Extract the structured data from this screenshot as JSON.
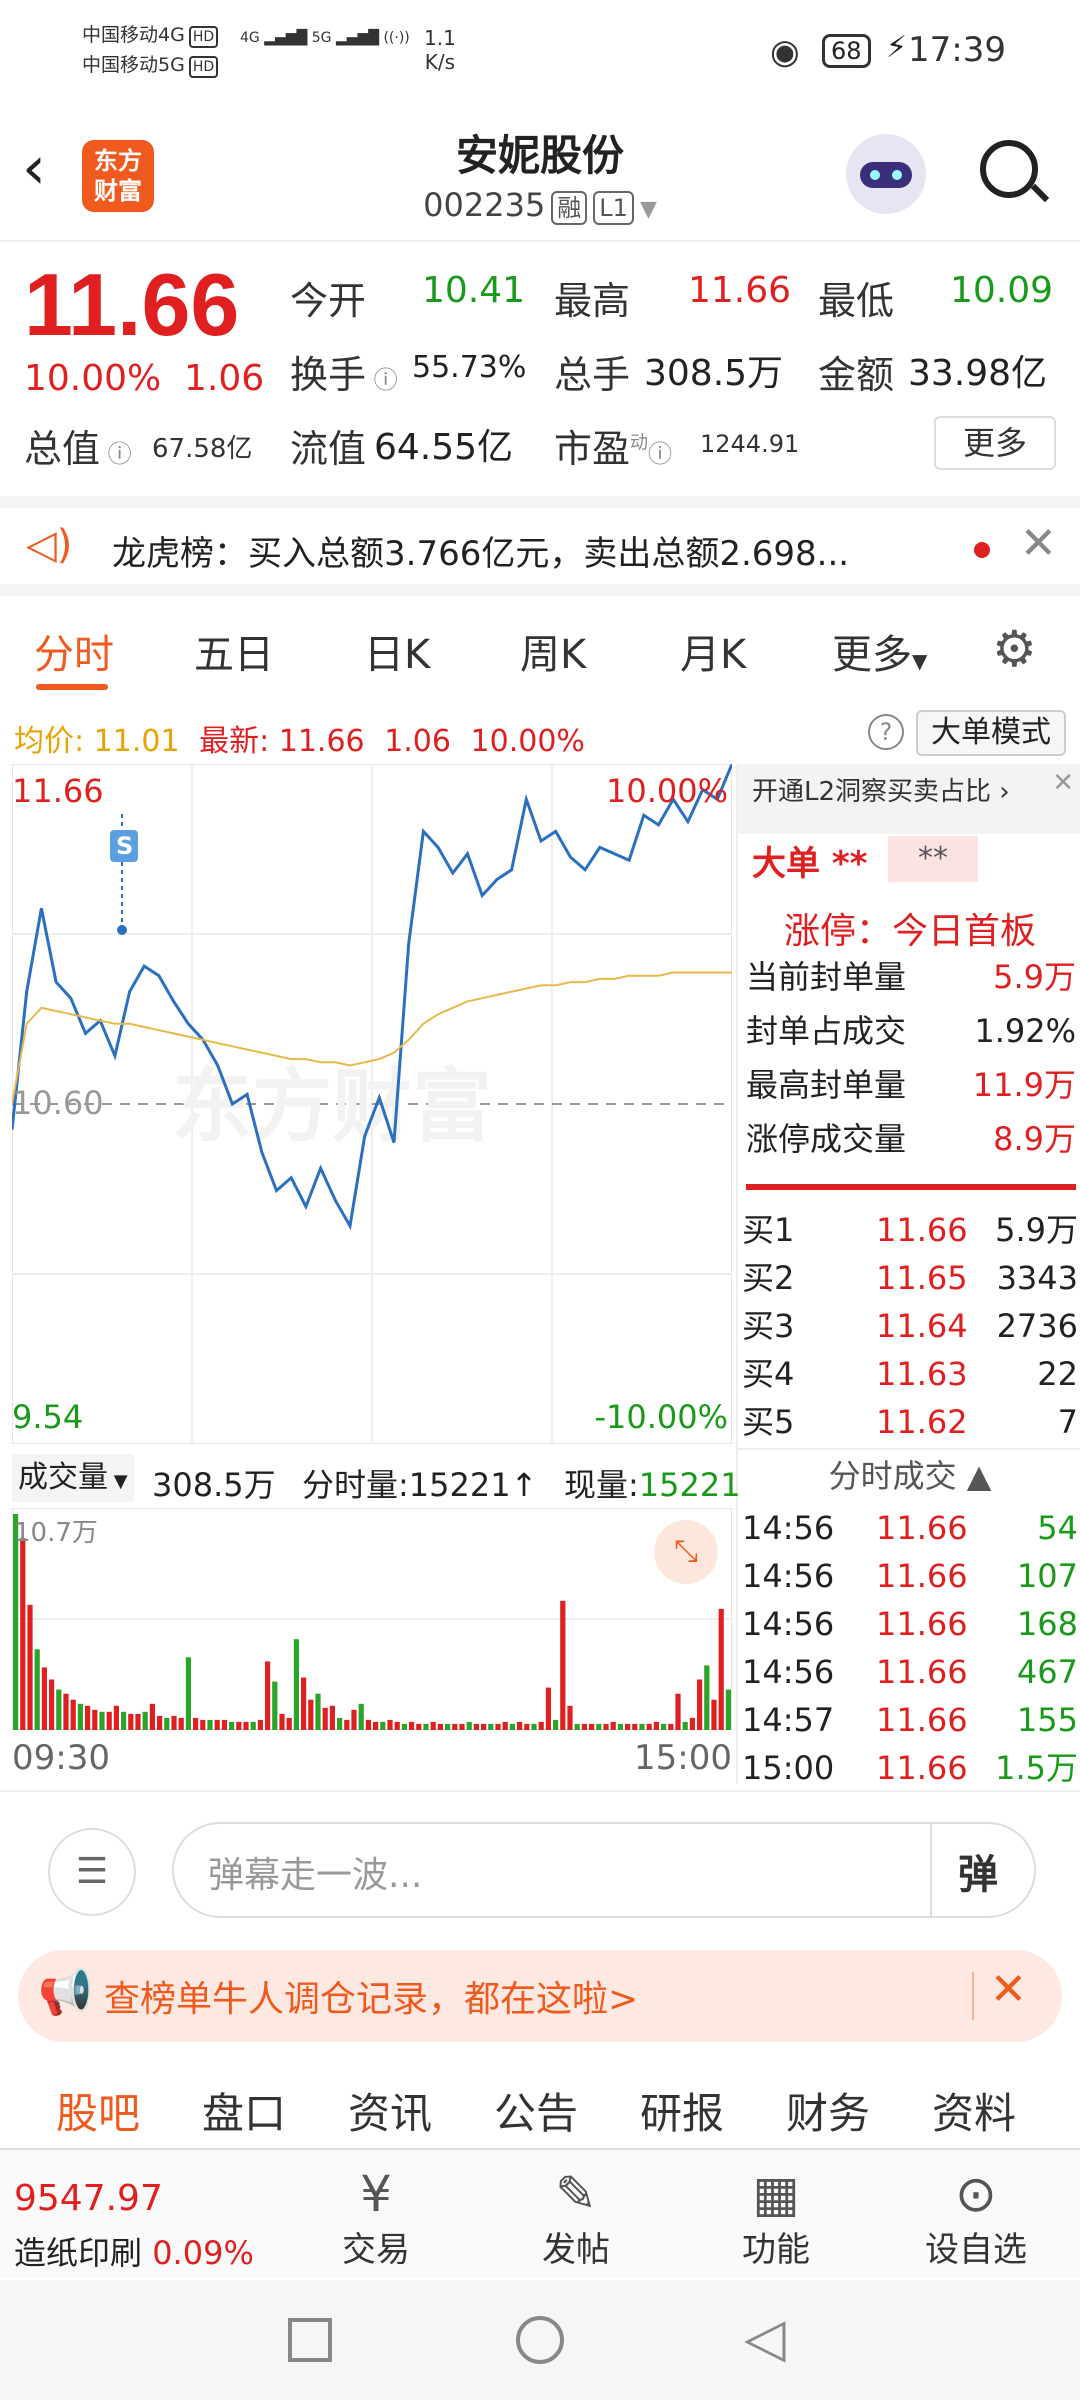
{
  "status": {
    "carrier1": "中国移动4G",
    "carrier2": "中国移动5G",
    "hd": "HD",
    "net1": "4G",
    "net2": "5G",
    "speed": "1.1",
    "speed_unit": "K/s",
    "battery": "68",
    "time": "17:39"
  },
  "header": {
    "logo_line1": "东方",
    "logo_line2": "财富",
    "title": "安妮股份",
    "code": "002235",
    "tag1": "融",
    "tag2": "L1"
  },
  "quote": {
    "price": "11.66",
    "change_pct": "10.00%",
    "change": "1.06",
    "open_label": "今开",
    "open": "10.41",
    "high_label": "最高",
    "high": "11.66",
    "low_label": "最低",
    "low": "10.09",
    "turnover_label": "换手",
    "turnover": "55.73%",
    "volume_label": "总手",
    "volume": "308.5万",
    "amount_label": "金额",
    "amount": "33.98亿",
    "mktcap_label": "总值",
    "mktcap": "67.58亿",
    "float_label": "流值",
    "float": "64.55亿",
    "pe_label": "市盈",
    "pe_sup": "动",
    "pe": "1244.91",
    "more": "更多"
  },
  "notice": {
    "text": "龙虎榜：买入总额3.766亿元，卖出总额2.698..."
  },
  "tabs": [
    "分时",
    "五日",
    "日K",
    "周K",
    "月K",
    "更多"
  ],
  "avgbar": {
    "avg_label": "均价:",
    "avg": "11.01",
    "latest_label": "最新:",
    "latest": "11.66",
    "change": "1.06",
    "pct": "10.00%",
    "mode_btn": "大单模式",
    "help": "?"
  },
  "chart": {
    "top_price": "11.66",
    "top_pct": "10.00%",
    "mid_price": "10.60",
    "bottom_price": "9.54",
    "bottom_pct": "-10.00%",
    "marker": "S",
    "watermark": "东方财富"
  },
  "chart_data": {
    "type": "line",
    "title": "",
    "xlabel": "",
    "ylabel": "",
    "ylim": [
      9.54,
      11.66
    ],
    "series": [
      {
        "name": "",
        "color": "#2a6fc0",
        "values": [
          10.52,
          10.95,
          11.21,
          10.98,
          10.93,
          10.82,
          10.86,
          10.75,
          10.95,
          11.03,
          11.0,
          10.92,
          10.85,
          10.8,
          10.72,
          10.6,
          10.63,
          10.45,
          10.33,
          10.37,
          10.28,
          10.4,
          10.3,
          10.22,
          10.5,
          10.62,
          10.48,
          11.1,
          11.45,
          11.4,
          11.32,
          11.38,
          11.25,
          11.3,
          11.33,
          11.55,
          11.42,
          11.45,
          11.37,
          11.33,
          11.4,
          11.38,
          11.36,
          11.5,
          11.47,
          11.55,
          11.48,
          11.58,
          11.55,
          11.66
        ]
      },
      {
        "name": "",
        "color": "#e8b84a",
        "values": [
          10.6,
          10.85,
          10.9,
          10.89,
          10.88,
          10.87,
          10.86,
          10.85,
          10.85,
          10.84,
          10.83,
          10.82,
          10.81,
          10.8,
          10.79,
          10.78,
          10.77,
          10.76,
          10.75,
          10.74,
          10.74,
          10.73,
          10.73,
          10.72,
          10.73,
          10.74,
          10.76,
          10.8,
          10.85,
          10.88,
          10.9,
          10.92,
          10.93,
          10.94,
          10.95,
          10.96,
          10.97,
          10.97,
          10.98,
          10.98,
          10.99,
          10.99,
          11.0,
          11.0,
          11.0,
          11.01,
          11.01,
          11.01,
          11.01,
          11.01
        ]
      }
    ],
    "volume_max_label": "10.7万",
    "volume": [
      10.7,
      9.5,
      6.2,
      4.0,
      3.1,
      2.5,
      2.0,
      1.8,
      1.5,
      1.3,
      1.2,
      1.0,
      0.9,
      0.9,
      1.2,
      0.9,
      0.8,
      0.8,
      0.9,
      1.3,
      0.7,
      0.6,
      0.7,
      0.6,
      3.6,
      0.6,
      0.5,
      0.5,
      0.5,
      0.5,
      0.4,
      0.4,
      0.4,
      0.4,
      0.5,
      3.4,
      2.4,
      0.8,
      0.6,
      4.5,
      2.6,
      1.5,
      1.8,
      1.1,
      1.2,
      0.6,
      0.5,
      1.0,
      1.3,
      0.5,
      0.4,
      0.4,
      0.5,
      0.4,
      0.3,
      0.4,
      0.3,
      0.3,
      0.4,
      0.3,
      0.3,
      0.3,
      0.3,
      0.4,
      0.3,
      0.3,
      0.3,
      0.3,
      0.4,
      0.3,
      0.4,
      0.3,
      0.3,
      0.4,
      2.1,
      0.5,
      6.4,
      1.2,
      0.3,
      0.3,
      0.3,
      0.3,
      0.3,
      0.4,
      0.3,
      0.3,
      0.3,
      0.3,
      0.3,
      0.4,
      0.3,
      0.3,
      1.8,
      0.4,
      0.6,
      2.5,
      3.2,
      1.5,
      6.0,
      2.0
    ],
    "x_start": "09:30",
    "x_end": "15:00"
  },
  "volbar": {
    "label": "成交量",
    "value": "308.5万",
    "tick_label": "分时量:",
    "tick_val": "15221",
    "now_label": "现量:",
    "now_val": "15221"
  },
  "rightpanel": {
    "promo": "开通L2洞察买卖占比",
    "big_label": "大单",
    "big_val1": "**",
    "big_val2": "**",
    "limit_title": "涨停：今日首板",
    "rows": [
      {
        "label": "当前封单量",
        "value": "5.9万"
      },
      {
        "label": "封单占成交",
        "value": "1.92%"
      },
      {
        "label": "最高封单量",
        "value": "11.9万"
      },
      {
        "label": "涨停成交量",
        "value": "8.9万"
      }
    ],
    "bids": [
      {
        "label": "买1",
        "price": "11.66",
        "qty": "5.9万"
      },
      {
        "label": "买2",
        "price": "11.65",
        "qty": "3343"
      },
      {
        "label": "买3",
        "price": "11.64",
        "qty": "2736"
      },
      {
        "label": "买4",
        "price": "11.63",
        "qty": "22"
      },
      {
        "label": "买5",
        "price": "11.62",
        "qty": "7"
      }
    ],
    "ticks_title": "分时成交",
    "ticks": [
      {
        "time": "14:56",
        "price": "11.66",
        "qty": "54"
      },
      {
        "time": "14:56",
        "price": "11.66",
        "qty": "107"
      },
      {
        "time": "14:56",
        "price": "11.66",
        "qty": "168"
      },
      {
        "time": "14:56",
        "price": "11.66",
        "qty": "467"
      },
      {
        "time": "14:57",
        "price": "11.66",
        "qty": "155"
      },
      {
        "time": "15:00",
        "price": "11.66",
        "qty": "1.5万"
      }
    ]
  },
  "danmu": {
    "placeholder": "弹幕走一波...",
    "send": "弹"
  },
  "promo": {
    "text": "查榜单牛人调仓记录，都在这啦>"
  },
  "bottomtabs": [
    "股吧",
    "盘口",
    "资讯",
    "公告",
    "研报",
    "财务",
    "资料"
  ],
  "toolbar": {
    "index_value": "9547.97",
    "index_name": "造纸印刷",
    "index_pct": "0.09%",
    "items": [
      "交易",
      "发帖",
      "功能",
      "设自选"
    ]
  }
}
